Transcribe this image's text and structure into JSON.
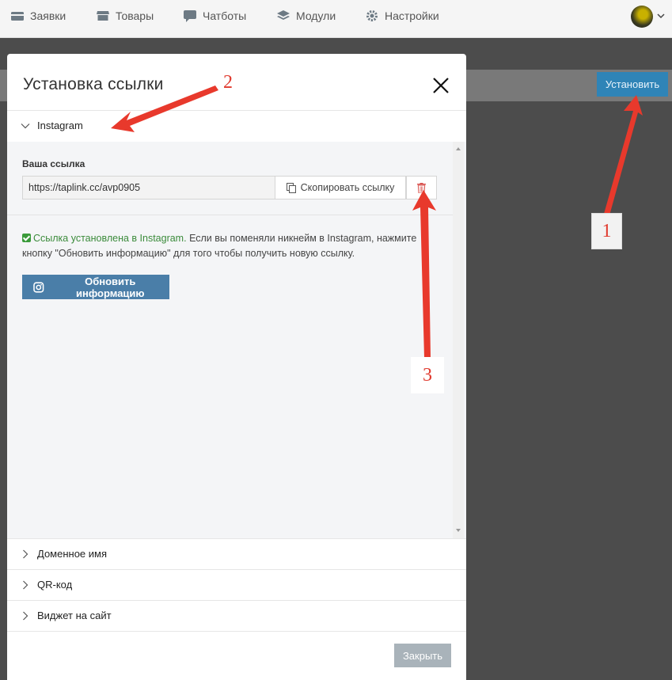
{
  "nav": {
    "items": [
      {
        "label": "Заявки",
        "icon": "card-icon"
      },
      {
        "label": "Товары",
        "icon": "store-icon"
      },
      {
        "label": "Чатботы",
        "icon": "chat-icon"
      },
      {
        "label": "Модули",
        "icon": "layers-icon"
      },
      {
        "label": "Настройки",
        "icon": "gear-icon"
      }
    ]
  },
  "page": {
    "install_label": "Установить"
  },
  "modal": {
    "title": "Установка ссылки",
    "sections": {
      "instagram": "Instagram",
      "domain": "Доменное имя",
      "qr": "QR-код",
      "widget": "Виджет на сайт"
    },
    "link_label": "Ваша ссылка",
    "link_value": "https://taplink.cc/avp0905",
    "copy_label": "Скопировать ссылку",
    "status_ok": "Ссылка установлена в Instagram.",
    "status_rest": "Если вы поменяли никнейм в Instagram, нажмите кнопку \"Обновить информацию\" для того чтобы получить новую ссылку.",
    "refresh_label": "Обновить информацию",
    "close_label": "Закрыть"
  },
  "annotations": {
    "n1": "1",
    "n2": "2",
    "n3": "3",
    "color": "#e03a2e"
  },
  "colors": {
    "primary": "#2f84b7",
    "instagram_button": "#4a7ea8",
    "success": "#3b8b3b",
    "danger": "#d9534f"
  }
}
